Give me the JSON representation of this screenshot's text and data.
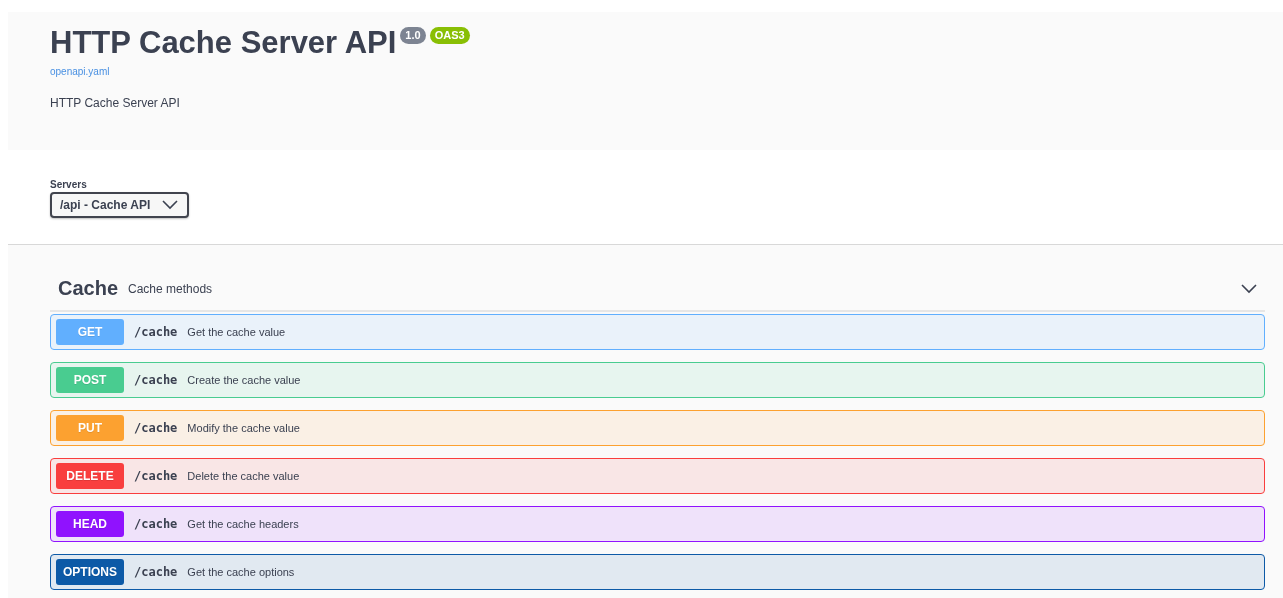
{
  "info": {
    "title": "HTTP Cache Server API",
    "version": "1.0",
    "spec_badge": "OAS3",
    "spec_link": "openapi.yaml",
    "description": "HTTP Cache Server API"
  },
  "servers": {
    "label": "Servers",
    "selected_value": "/api - Cache API"
  },
  "tag": {
    "name": "Cache",
    "description": "Cache methods",
    "expanded": true,
    "operations": [
      {
        "method": "GET",
        "color": "#61affe",
        "path": "/cache",
        "summary": "Get the cache value"
      },
      {
        "method": "POST",
        "color": "#49cc90",
        "path": "/cache",
        "summary": "Create the cache value"
      },
      {
        "method": "PUT",
        "color": "#fca130",
        "path": "/cache",
        "summary": "Modify the cache value"
      },
      {
        "method": "DELETE",
        "color": "#f93e3e",
        "path": "/cache",
        "summary": "Delete the cache value"
      },
      {
        "method": "HEAD",
        "color": "#9012fe",
        "path": "/cache",
        "summary": "Get the cache headers"
      },
      {
        "method": "OPTIONS",
        "color": "#0d5aa7",
        "path": "/cache",
        "summary": "Get the cache options"
      }
    ]
  }
}
